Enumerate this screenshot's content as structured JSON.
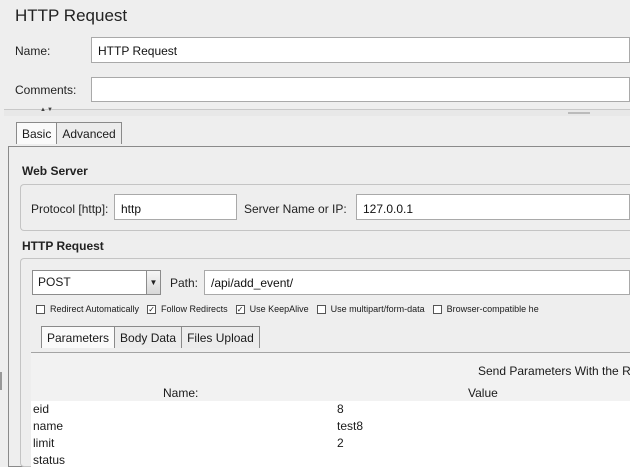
{
  "window": {
    "title": "HTTP Request"
  },
  "fields": {
    "name_label": "Name:",
    "name_value": "HTTP Request",
    "comments_label": "Comments:",
    "comments_value": ""
  },
  "main_tabs": [
    {
      "label": "Basic",
      "active": true
    },
    {
      "label": "Advanced",
      "active": false
    }
  ],
  "web_server": {
    "title": "Web Server",
    "protocol_label": "Protocol [http]:",
    "protocol_value": "http",
    "server_label": "Server Name or IP:",
    "server_value": "127.0.0.1"
  },
  "http_request": {
    "title": "HTTP Request",
    "method": "POST",
    "path_label": "Path:",
    "path_value": "/api/add_event/",
    "options": [
      {
        "label": "Redirect Automatically",
        "checked": false
      },
      {
        "label": "Follow Redirects",
        "checked": true
      },
      {
        "label": "Use KeepAlive",
        "checked": true
      },
      {
        "label": "Use multipart/form-data",
        "checked": false
      },
      {
        "label": "Browser-compatible he",
        "checked": false
      }
    ]
  },
  "param_tabs": [
    {
      "label": "Parameters",
      "active": true
    },
    {
      "label": "Body Data",
      "active": false
    },
    {
      "label": "Files Upload",
      "active": false
    }
  ],
  "params_table": {
    "send_label": "Send Parameters With the R",
    "columns": [
      "Name:",
      "Value"
    ],
    "rows": [
      {
        "name": "eid",
        "value": "8"
      },
      {
        "name": "name",
        "value": "test8"
      },
      {
        "name": "limit",
        "value": "2"
      },
      {
        "name": "status",
        "value": ""
      }
    ]
  }
}
